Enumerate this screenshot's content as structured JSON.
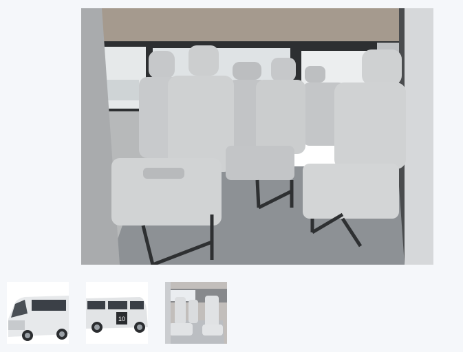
{
  "gallery": {
    "main_image": {
      "icon": "van-interior-photo"
    },
    "thumbnails": [
      {
        "icon": "van-exterior-front-photo",
        "active": false
      },
      {
        "icon": "van-exterior-side-photo",
        "active": false,
        "badge_text": "10"
      },
      {
        "icon": "van-interior-photo",
        "active": true
      }
    ]
  },
  "colors": {
    "page_background": "#f5f7fa",
    "seat": "#c9cbcd",
    "floor": "#8d9195",
    "body_silver": "#d8dadc"
  }
}
